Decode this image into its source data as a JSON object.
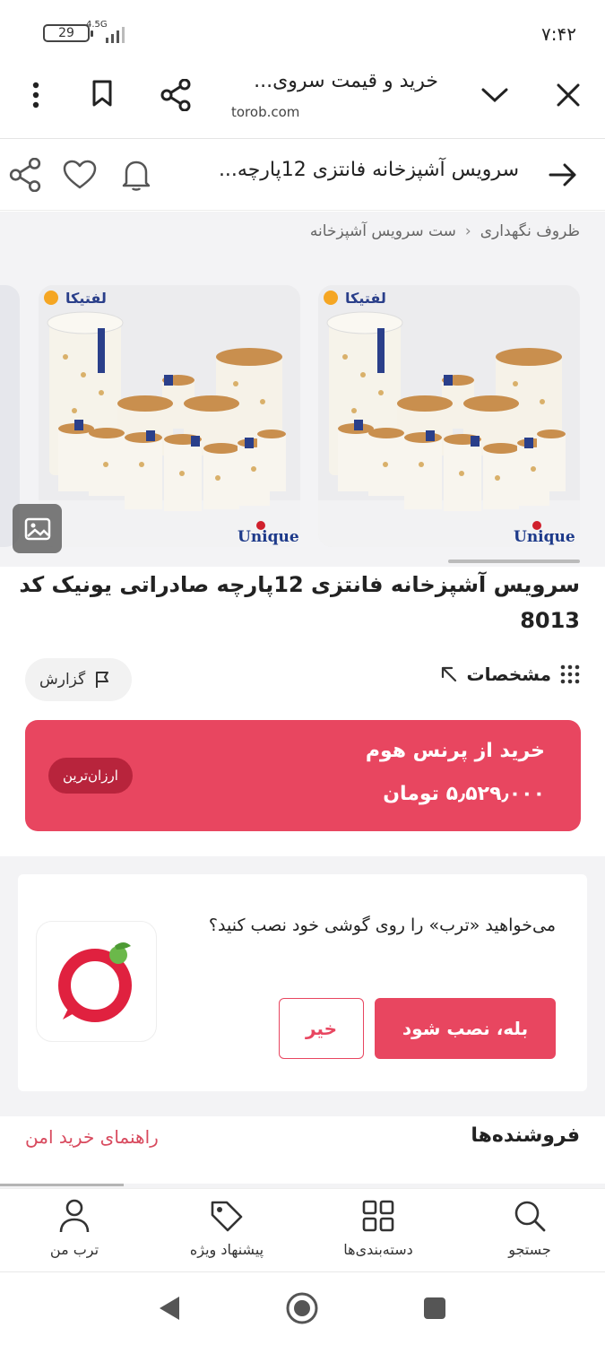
{
  "status": {
    "battery": "29",
    "network": "4.5G",
    "time": "۷:۴۲"
  },
  "browser": {
    "title": "خرید و قیمت سروی...",
    "url": "torob.com"
  },
  "page_header": {
    "title": "سرویس آشپزخانه فانتزی 12پارچه..."
  },
  "breadcrumb": {
    "items": [
      "ظروف نگهداری",
      "ست سرویس آشپزخانه"
    ],
    "separator": "‹"
  },
  "product": {
    "title": "سرویس آشپزخانه فانتزی 12پارچه صادراتی یونیک کد 8013",
    "image_brand": "Unique",
    "image_logo": "لفتیکا",
    "specs_label": "مشخصات",
    "report_label": "گزارش"
  },
  "offer": {
    "store": "خرید از پرنس هوم",
    "price": "۵٫۵۲۹٫۰۰۰ تومان",
    "badge": "ارزان‌ترین"
  },
  "install": {
    "question": "می‌خواهید «ترب» را روی گوشی خود نصب کنید؟",
    "yes_label": "بله، نصب شود",
    "no_label": "خیر"
  },
  "sellers": {
    "title": "فروشنده‌ها",
    "guide_link": "راهنمای خرید امن"
  },
  "bottom_nav": {
    "search": "جستجو",
    "categories": "دسته‌بندی‌ها",
    "offers": "پیشنهاد ویژه",
    "my_torob": "ترب من"
  },
  "colors": {
    "accent": "#e84660",
    "badge": "#b8243c",
    "link": "#d84a5e"
  }
}
